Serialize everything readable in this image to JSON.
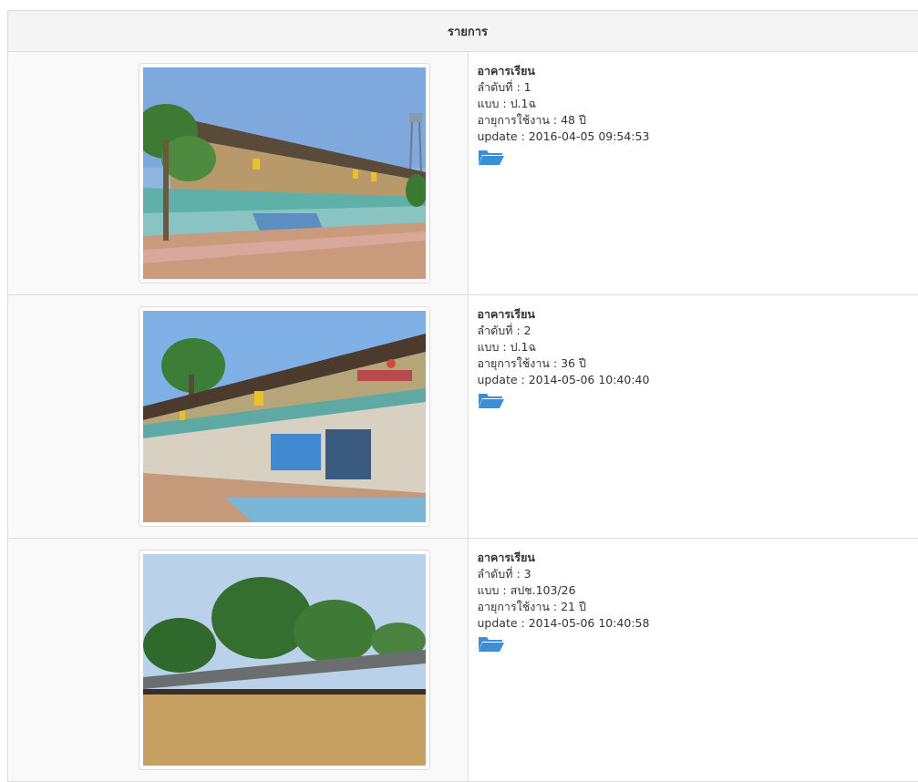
{
  "table": {
    "header": "รายการ"
  },
  "rows": [
    {
      "title": "อาคารเรียน",
      "order": "ลำดับที่ : 1",
      "type": "แบบ : ป.1ฉ",
      "age": "อายุการใช้งาน : 48 ปี",
      "update": "update : 2016-04-05 09:54:53"
    },
    {
      "title": "อาคารเรียน",
      "order": "ลำดับที่ : 2",
      "type": "แบบ : ป.1ฉ",
      "age": "อายุการใช้งาน : 36 ปี",
      "update": "update : 2014-05-06 10:40:40"
    },
    {
      "title": "อาคารเรียน",
      "order": "ลำดับที่ : 3",
      "type": "แบบ : สปช.103/26",
      "age": "อายุการใช้งาน : 21 ปี",
      "update": "update : 2014-05-06 10:40:58"
    }
  ],
  "colors": {
    "folder_icon": "#3a8fd6",
    "border": "#dddddd",
    "header_bg": "#f4f4f4"
  },
  "icons": {
    "folder": "folder-open-icon"
  }
}
